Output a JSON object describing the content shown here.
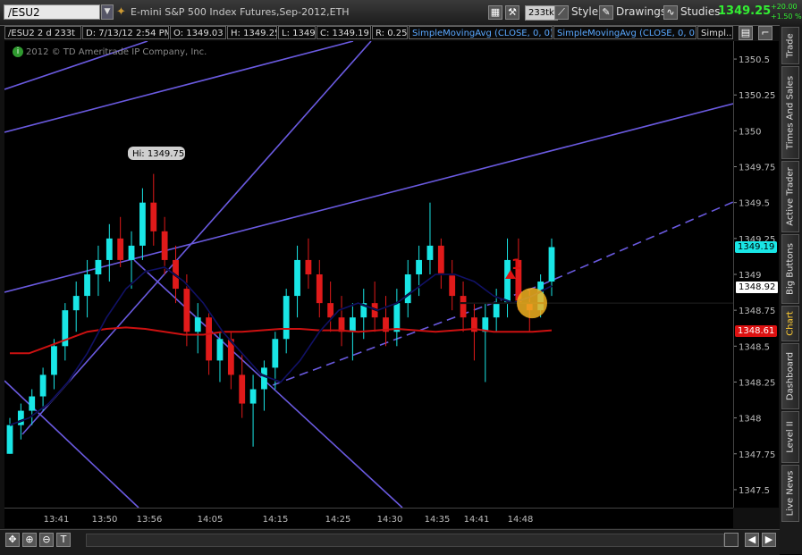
{
  "toolbar": {
    "symbol": "/ESU2",
    "description": "E-mini S&P 500 Index Futures,Sep-2012,ETH",
    "aggregation": "233tk",
    "style_label": "Style",
    "drawings_label": "Drawings",
    "studies_label": "Studies",
    "last_price": "1349.25",
    "change_abs": "+20.00",
    "change_pct": "+1.50 %"
  },
  "infobar": {
    "symbol_period": "/ESU2 2 d 233t",
    "date": "D: 7/13/12 2:54 PM",
    "open": "O: 1349.03",
    "high": "H: 1349.25",
    "low": "L: 1349",
    "close": "C: 1349.19",
    "range": "R: 0.25",
    "study1": "SimpleMovingAvg (CLOSE, 0, 0)",
    "study2": "SimpleMovingAvg (CLOSE, 0, 0)",
    "study3": "Simpl..."
  },
  "chart": {
    "copyright": "2012 © TD Ameritrade IP Company, Inc.",
    "hi_bubble": "Hi: 1349.75",
    "tag_price": "1349.19",
    "tag_sma_fast": "1348.92",
    "tag_sma_slow": "1348.61",
    "annotation_label": "1"
  },
  "chart_data": {
    "type": "candlestick",
    "ylim": [
      1347.375,
      1350.625
    ],
    "y_ticks": [
      "1350.5",
      "1350.25",
      "1350",
      "1349.75",
      "1349.5",
      "1349.25",
      "1349",
      "1348.75",
      "1348.5",
      "1348.25",
      "1348",
      "1347.75",
      "1347.5"
    ],
    "x_ticks": [
      "13:41",
      "13:50",
      "13:56",
      "14:05",
      "14:15",
      "14:25",
      "14:30",
      "14:35",
      "14:41",
      "14:48"
    ],
    "colors": {
      "up": "#19e6e6",
      "down": "#e01a1a",
      "sma_fast": "#000000",
      "sma_slow": "#cc1111",
      "trendlines": "#6a5ae0"
    },
    "candles": [
      [
        1347.75,
        1348.0,
        1347.75,
        1347.95
      ],
      [
        1347.95,
        1348.1,
        1347.85,
        1348.05
      ],
      [
        1348.05,
        1348.2,
        1347.95,
        1348.15
      ],
      [
        1348.15,
        1348.35,
        1348.05,
        1348.3
      ],
      [
        1348.3,
        1348.55,
        1348.2,
        1348.5
      ],
      [
        1348.5,
        1348.8,
        1348.4,
        1348.75
      ],
      [
        1348.75,
        1348.95,
        1348.6,
        1348.85
      ],
      [
        1348.85,
        1349.1,
        1348.7,
        1349.0
      ],
      [
        1349.0,
        1349.2,
        1348.85,
        1349.1
      ],
      [
        1349.1,
        1349.35,
        1348.95,
        1349.25
      ],
      [
        1349.25,
        1349.4,
        1349.05,
        1349.1
      ],
      [
        1349.1,
        1349.3,
        1348.9,
        1349.2
      ],
      [
        1349.2,
        1349.6,
        1349.1,
        1349.5
      ],
      [
        1349.5,
        1349.7,
        1349.2,
        1349.3
      ],
      [
        1349.3,
        1349.4,
        1349.0,
        1349.1
      ],
      [
        1349.1,
        1349.2,
        1348.8,
        1348.9
      ],
      [
        1348.9,
        1349.0,
        1348.5,
        1348.6
      ],
      [
        1348.6,
        1348.8,
        1348.45,
        1348.7
      ],
      [
        1348.7,
        1348.75,
        1348.3,
        1348.4
      ],
      [
        1348.4,
        1348.6,
        1348.25,
        1348.55
      ],
      [
        1348.55,
        1348.6,
        1348.2,
        1348.3
      ],
      [
        1348.3,
        1348.45,
        1348.0,
        1348.1
      ],
      [
        1348.1,
        1348.3,
        1347.8,
        1348.2
      ],
      [
        1348.2,
        1348.4,
        1348.05,
        1348.35
      ],
      [
        1348.35,
        1348.6,
        1348.2,
        1348.55
      ],
      [
        1348.55,
        1348.9,
        1348.45,
        1348.85
      ],
      [
        1348.85,
        1349.2,
        1348.7,
        1349.1
      ],
      [
        1349.1,
        1349.25,
        1348.9,
        1349.0
      ],
      [
        1349.0,
        1349.1,
        1348.7,
        1348.8
      ],
      [
        1348.8,
        1348.95,
        1348.6,
        1348.7
      ],
      [
        1348.7,
        1348.85,
        1348.5,
        1348.6
      ],
      [
        1348.6,
        1348.8,
        1348.4,
        1348.7
      ],
      [
        1348.7,
        1348.9,
        1348.55,
        1348.8
      ],
      [
        1348.8,
        1348.95,
        1348.6,
        1348.7
      ],
      [
        1348.7,
        1348.85,
        1348.5,
        1348.6
      ],
      [
        1348.6,
        1348.9,
        1348.5,
        1348.8
      ],
      [
        1348.8,
        1349.1,
        1348.7,
        1349.0
      ],
      [
        1349.0,
        1349.2,
        1348.85,
        1349.1
      ],
      [
        1349.1,
        1349.5,
        1349.0,
        1349.2
      ],
      [
        1349.2,
        1349.25,
        1348.9,
        1349.0
      ],
      [
        1349.0,
        1349.1,
        1348.75,
        1348.85
      ],
      [
        1348.85,
        1348.95,
        1348.6,
        1348.7
      ],
      [
        1348.7,
        1348.8,
        1348.4,
        1348.6
      ],
      [
        1348.6,
        1348.8,
        1348.25,
        1348.7
      ],
      [
        1348.7,
        1348.9,
        1348.6,
        1348.8
      ],
      [
        1348.8,
        1349.25,
        1348.7,
        1349.1
      ],
      [
        1349.1,
        1349.25,
        1348.75,
        1348.8
      ],
      [
        1348.8,
        1348.9,
        1348.6,
        1348.75
      ],
      [
        1348.75,
        1349.0,
        1348.7,
        1348.95
      ],
      [
        1348.95,
        1349.25,
        1348.85,
        1349.19
      ]
    ],
    "sma_fast": [
      1347.95,
      1348.0,
      1348.1,
      1348.25,
      1348.45,
      1348.7,
      1348.9,
      1349.02,
      1349.05,
      1348.95,
      1348.8,
      1348.6,
      1348.45,
      1348.3,
      1348.25,
      1348.4,
      1348.6,
      1348.75,
      1348.8,
      1348.75,
      1348.8,
      1348.9,
      1349.0,
      1349.0,
      1348.95,
      1348.85,
      1348.8,
      1348.85,
      1348.92
    ],
    "sma_slow": [
      1348.45,
      1348.45,
      1348.5,
      1348.55,
      1348.6,
      1348.62,
      1348.63,
      1348.62,
      1348.6,
      1348.58,
      1348.58,
      1348.6,
      1348.6,
      1348.61,
      1348.62,
      1348.62,
      1348.61,
      1348.61,
      1348.6,
      1348.61,
      1348.62,
      1348.61,
      1348.6,
      1348.61,
      1348.62,
      1348.6,
      1348.6,
      1348.6,
      1348.61
    ]
  },
  "right_tabs": [
    "Trade",
    "Times And Sales",
    "Active Trader",
    "Big Buttons",
    "Chart",
    "Dashboard",
    "Level II",
    "Live News"
  ]
}
